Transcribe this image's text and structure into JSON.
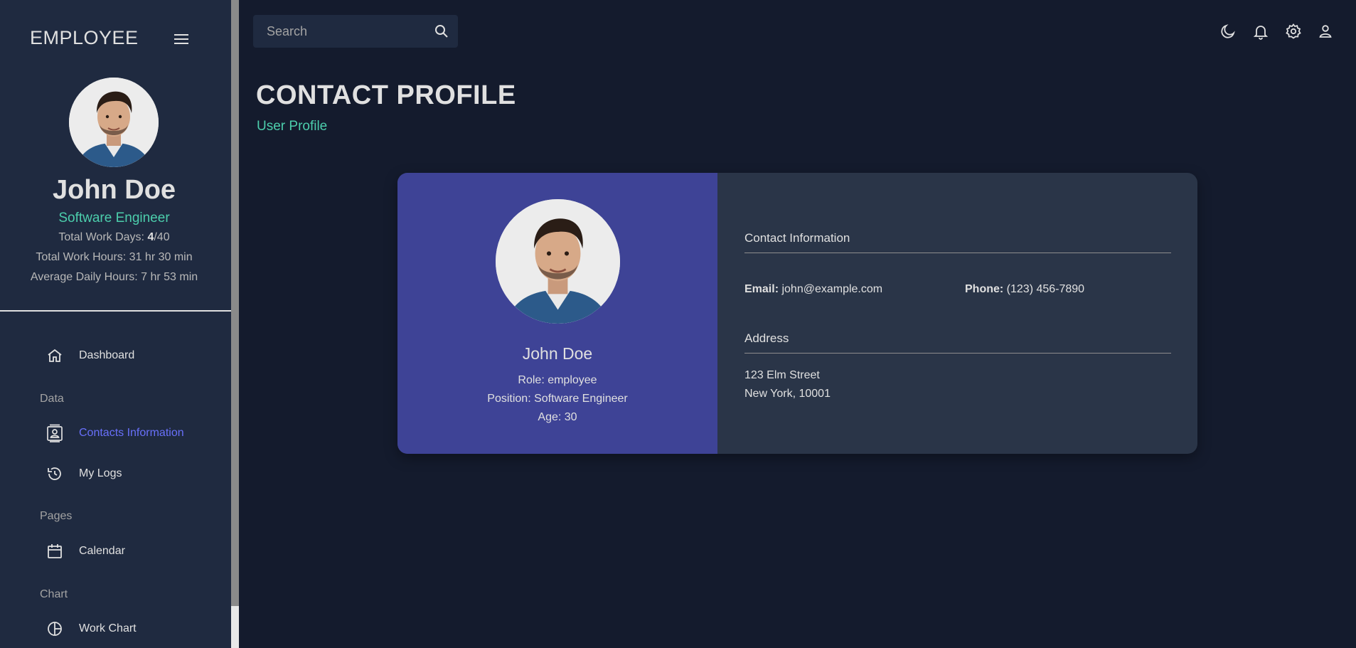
{
  "app": {
    "brand": "EMPLOYEE"
  },
  "sidebar": {
    "user_name": "John Doe",
    "user_role": "Software Engineer",
    "work_days_label": "Total Work Days: ",
    "work_days_done": "4",
    "work_days_total": "/40",
    "work_hours": "Total Work Hours: 31 hr 30 min",
    "avg_hours": "Average Daily Hours: 7 hr 53 min",
    "sections": {
      "data": "Data",
      "pages": "Pages",
      "chart": "Chart"
    },
    "items": [
      {
        "label": "Dashboard",
        "icon": "home-icon"
      },
      {
        "label": "Contacts Information",
        "icon": "contact-card-icon",
        "active": true
      },
      {
        "label": "My Logs",
        "icon": "history-icon"
      },
      {
        "label": "Calendar",
        "icon": "calendar-icon"
      },
      {
        "label": "Work Chart",
        "icon": "pie-chart-icon"
      }
    ]
  },
  "topbar": {
    "search_placeholder": "Search",
    "icons": [
      "dark-mode-icon",
      "notifications-icon",
      "settings-icon",
      "person-icon"
    ]
  },
  "header": {
    "title": "CONTACT PROFILE",
    "subtitle": "User Profile"
  },
  "profile": {
    "name": "John Doe",
    "role": "Role: employee",
    "position": "Position: Software Engineer",
    "age": "Age: 30"
  },
  "contact": {
    "section_title": "Contact Information",
    "email_label": "Email:",
    "email_value": " john@example.com",
    "phone_label": "Phone:",
    "phone_value": " (123) 456-7890",
    "address_title": "Address",
    "address_line1": "123 Elm Street",
    "address_line2": "New York, 10001"
  },
  "colors": {
    "background": "#141b2d",
    "sidebar": "#1f2a40",
    "accent_green": "#4cceac",
    "accent_blue": "#6870fa",
    "card_left": "#3e4396",
    "card_right": "#2a3548"
  }
}
